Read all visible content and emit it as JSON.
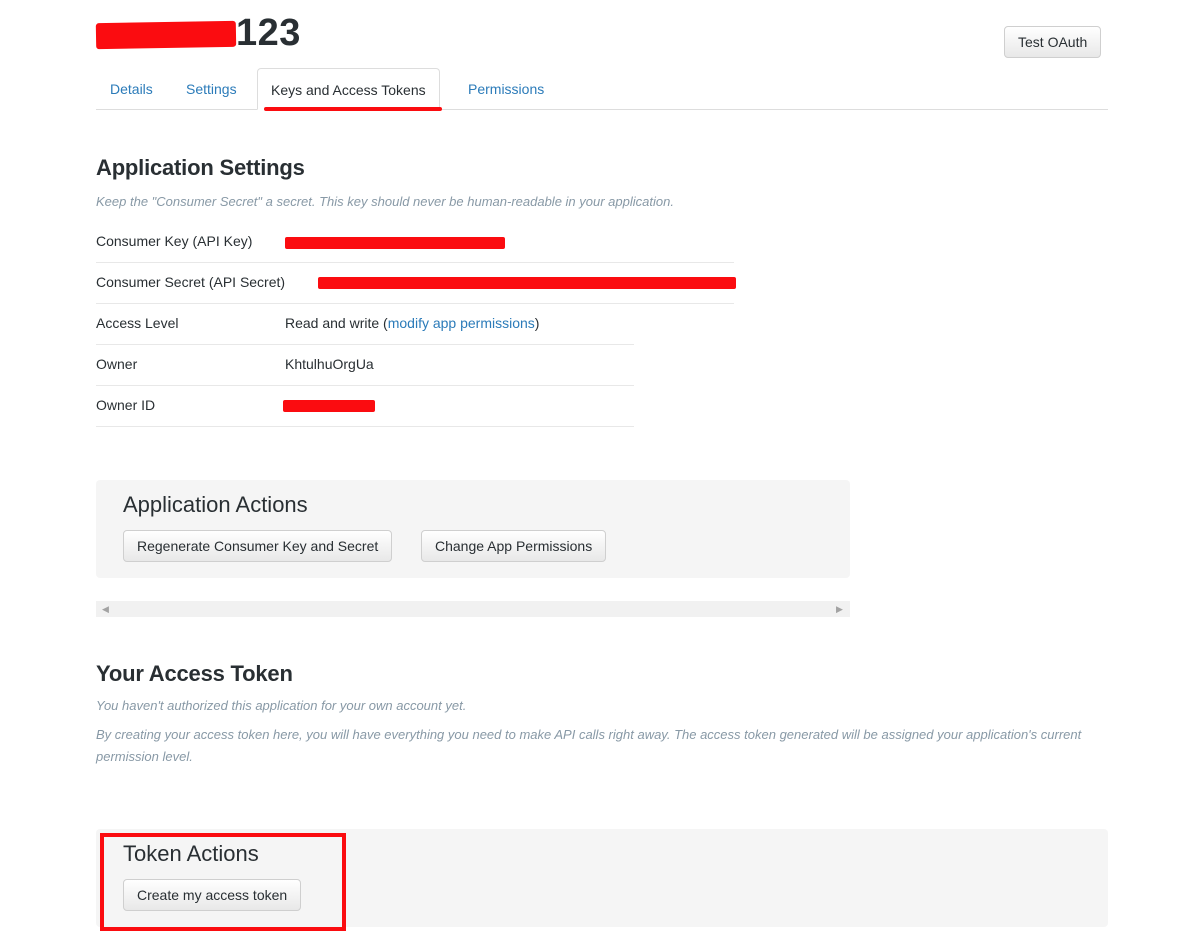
{
  "header": {
    "app_title_suffix": "123",
    "test_oauth_label": "Test OAuth"
  },
  "tabs": [
    {
      "label": "Details"
    },
    {
      "label": "Settings"
    },
    {
      "label": "Keys and Access Tokens"
    },
    {
      "label": "Permissions"
    }
  ],
  "app_settings": {
    "title": "Application Settings",
    "note": "Keep the \"Consumer Secret\" a secret. This key should never be human-readable in your application.",
    "rows": [
      {
        "key": "Consumer Key (API Key)",
        "value": ""
      },
      {
        "key": "Consumer Secret (API Secret)",
        "value": ""
      },
      {
        "key": "Access Level",
        "value_prefix": "Read and write (",
        "link": "modify app permissions",
        "value_suffix": ")"
      },
      {
        "key": "Owner",
        "value": "KhtulhuOrgUa"
      },
      {
        "key": "Owner ID",
        "value": ""
      }
    ]
  },
  "app_actions": {
    "title": "Application Actions",
    "regenerate_label": "Regenerate Consumer Key and Secret",
    "change_permissions_label": "Change App Permissions"
  },
  "access_token": {
    "title": "Your Access Token",
    "note1": "You haven't authorized this application for your own account yet.",
    "note2": "By creating your access token here, you will have everything you need to make API calls right away. The access token generated will be assigned your application's current permission level."
  },
  "token_actions": {
    "title": "Token Actions",
    "create_label": "Create my access token"
  },
  "scrollbar": {
    "left_arrow": "◀",
    "right_arrow": "▶"
  },
  "colors": {
    "link": "#2b7bb9",
    "redaction": "#fb0c10",
    "panel_bg": "#f5f5f5",
    "muted_text": "#8899a6"
  }
}
